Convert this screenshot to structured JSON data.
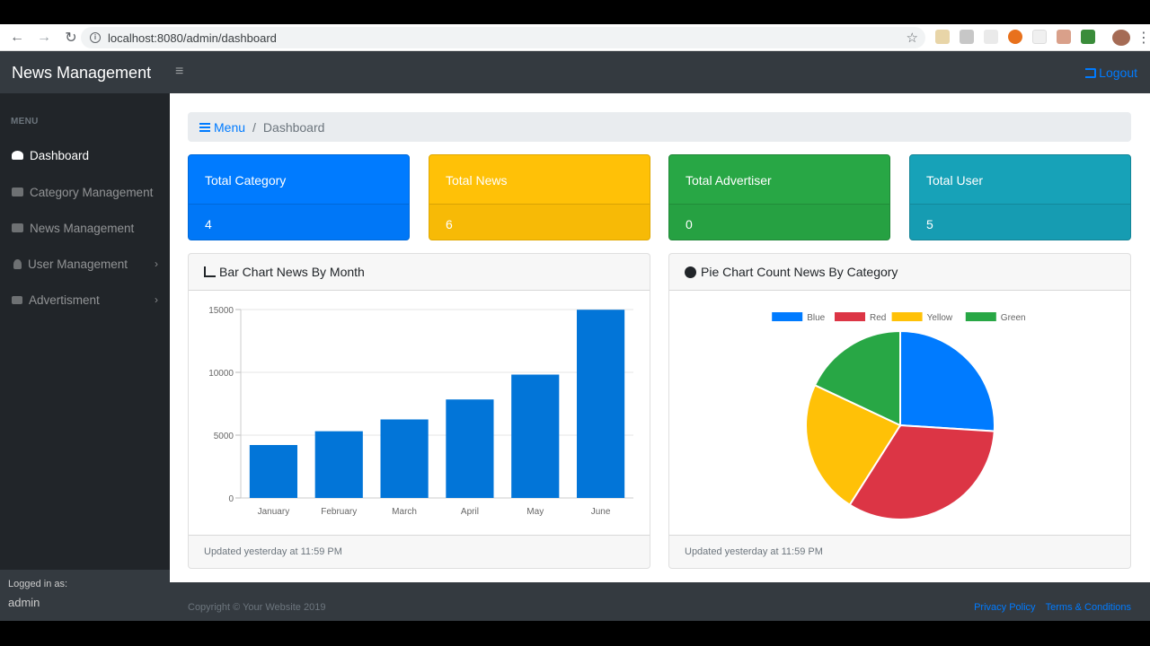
{
  "browser": {
    "url": "localhost:8080/admin/dashboard",
    "back_icon": "arrow-left-icon",
    "forward_icon": "arrow-right-icon",
    "reload_icon": "reload-icon"
  },
  "navbar": {
    "brand": "News Management",
    "toggle_icon": "hamburger-icon",
    "logout": "Logout"
  },
  "sidebar": {
    "heading": "MENU",
    "items": [
      {
        "label": "Dashboard",
        "icon": "tachometer-icon",
        "active": true,
        "has_children": false
      },
      {
        "label": "Category Management",
        "icon": "folder-open-icon",
        "active": false,
        "has_children": false
      },
      {
        "label": "News Management",
        "icon": "newspaper-icon",
        "active": false,
        "has_children": false
      },
      {
        "label": "User Management",
        "icon": "user-icon",
        "active": false,
        "has_children": true
      },
      {
        "label": "Advertisment",
        "icon": "ad-icon",
        "active": false,
        "has_children": true
      }
    ],
    "footer": {
      "label": "Logged in as:",
      "user": "admin"
    }
  },
  "breadcrumb": {
    "root": "Menu",
    "current": "Dashboard"
  },
  "stats": [
    {
      "label": "Total Category",
      "value": "4",
      "color": "#007bff"
    },
    {
      "label": "Total News",
      "value": "6",
      "color": "#ffc107"
    },
    {
      "label": "Total Advertiser",
      "value": "0",
      "color": "#28a745"
    },
    {
      "label": "Total User",
      "value": "5",
      "color": "#17a2b8"
    }
  ],
  "bar_card": {
    "title": "Bar Chart News By Month",
    "footer": "Updated yesterday at 11:59 PM"
  },
  "pie_card": {
    "title": "Pie Chart Count News By Category",
    "footer": "Updated yesterday at 11:59 PM"
  },
  "chart_data": [
    {
      "type": "bar",
      "categories": [
        "January",
        "February",
        "March",
        "April",
        "May",
        "June"
      ],
      "values": [
        4215,
        5312,
        6251,
        7841,
        9821,
        14984
      ],
      "ylim": [
        0,
        15000
      ],
      "yticks": [
        "0",
        "5000",
        "10000",
        "15000"
      ],
      "color": "#0275d8",
      "grid": true
    },
    {
      "type": "pie",
      "labels": [
        "Blue",
        "Red",
        "Yellow",
        "Green"
      ],
      "values": [
        26,
        33,
        23,
        18
      ],
      "colors": [
        "#007bff",
        "#dc3545",
        "#ffc107",
        "#28a745"
      ],
      "legend": "top"
    }
  ],
  "footer": {
    "copyright": "Copyright © Your Website 2019",
    "privacy": "Privacy Policy",
    "terms": "Terms & Conditions"
  }
}
